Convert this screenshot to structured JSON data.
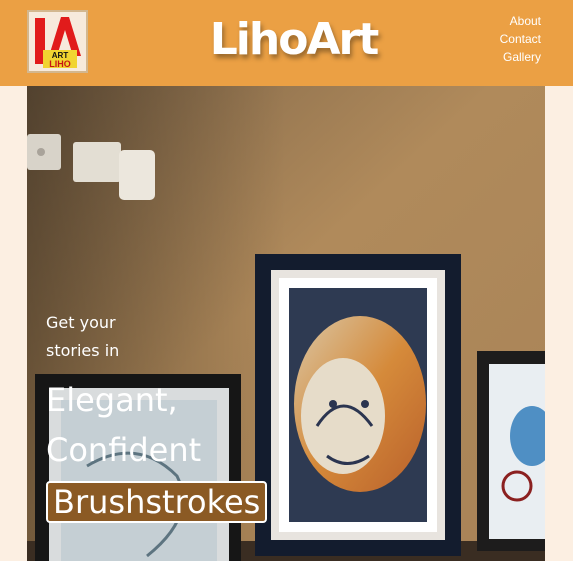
{
  "header": {
    "logo_text_top": "ART",
    "logo_text_bottom": "LIHO",
    "brand": "LihoArt",
    "nav": [
      "About",
      "Contact",
      "Gallery"
    ]
  },
  "hero": {
    "tagline_line1": "Get your",
    "tagline_line2": "stories in",
    "headline_line1": "Elegant,",
    "headline_line2": "Confident",
    "headline_highlight": "Brushstrokes"
  },
  "colors": {
    "header_bg": "#eba044",
    "page_bg": "#fcefe2",
    "highlight_bg": "#8b5a24"
  }
}
